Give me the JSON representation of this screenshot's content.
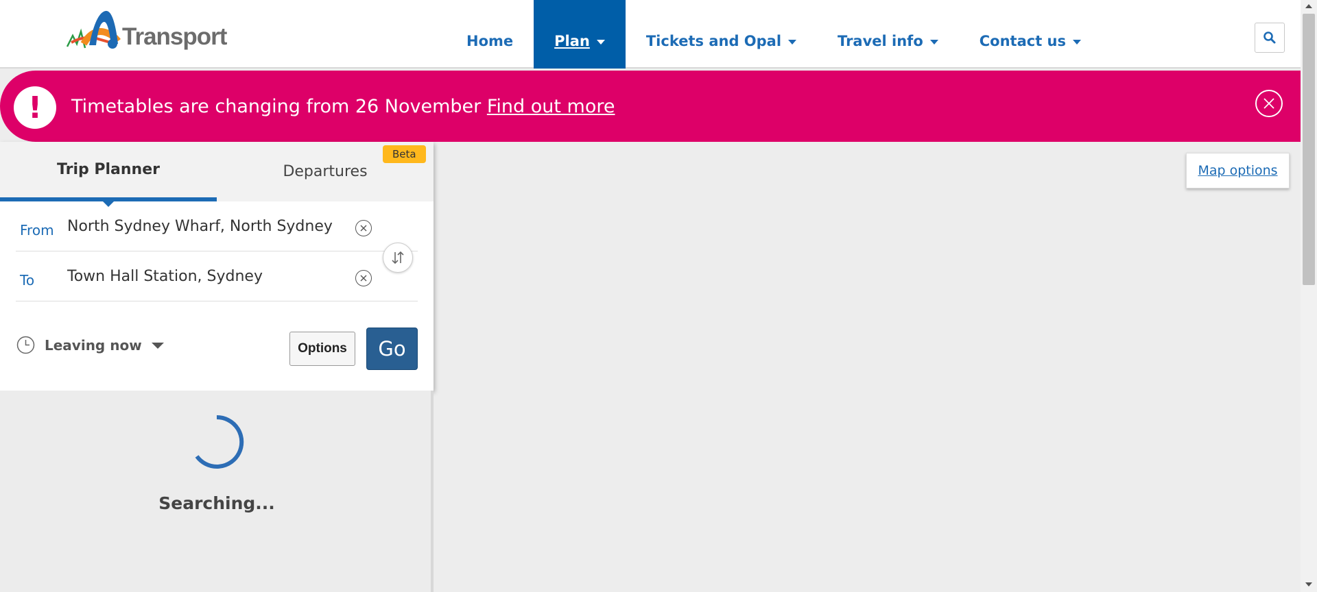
{
  "header": {
    "logo_text": "Transport",
    "nav": [
      {
        "label": "Home",
        "has_caret": false
      },
      {
        "label": "Plan",
        "has_caret": true,
        "active": true
      },
      {
        "label": "Tickets and Opal",
        "has_caret": true
      },
      {
        "label": "Travel info",
        "has_caret": true
      },
      {
        "label": "Contact us",
        "has_caret": true
      }
    ],
    "search_icon": "search-icon"
  },
  "alert": {
    "message": "Timetables are changing from 26 November ",
    "link": "Find out more",
    "color": "#dd0068"
  },
  "planner": {
    "tabs": [
      {
        "label": "Trip Planner",
        "active": true
      },
      {
        "label": "Departures",
        "active": false
      }
    ],
    "beta_label": "Beta",
    "from": {
      "label": "From",
      "value": "North Sydney Wharf, North Sydney"
    },
    "to": {
      "label": "To",
      "value": "Town Hall Station, Sydney"
    },
    "leaving_label": "Leaving now",
    "options_label": "Options",
    "go_label": "Go"
  },
  "results": {
    "status": "Searching..."
  },
  "map": {
    "options_label": "Map options"
  },
  "colors": {
    "primary": "#1c6bb5",
    "nav_active": "#005ea8",
    "go_button": "#295f92",
    "beta": "#ffb81c"
  }
}
